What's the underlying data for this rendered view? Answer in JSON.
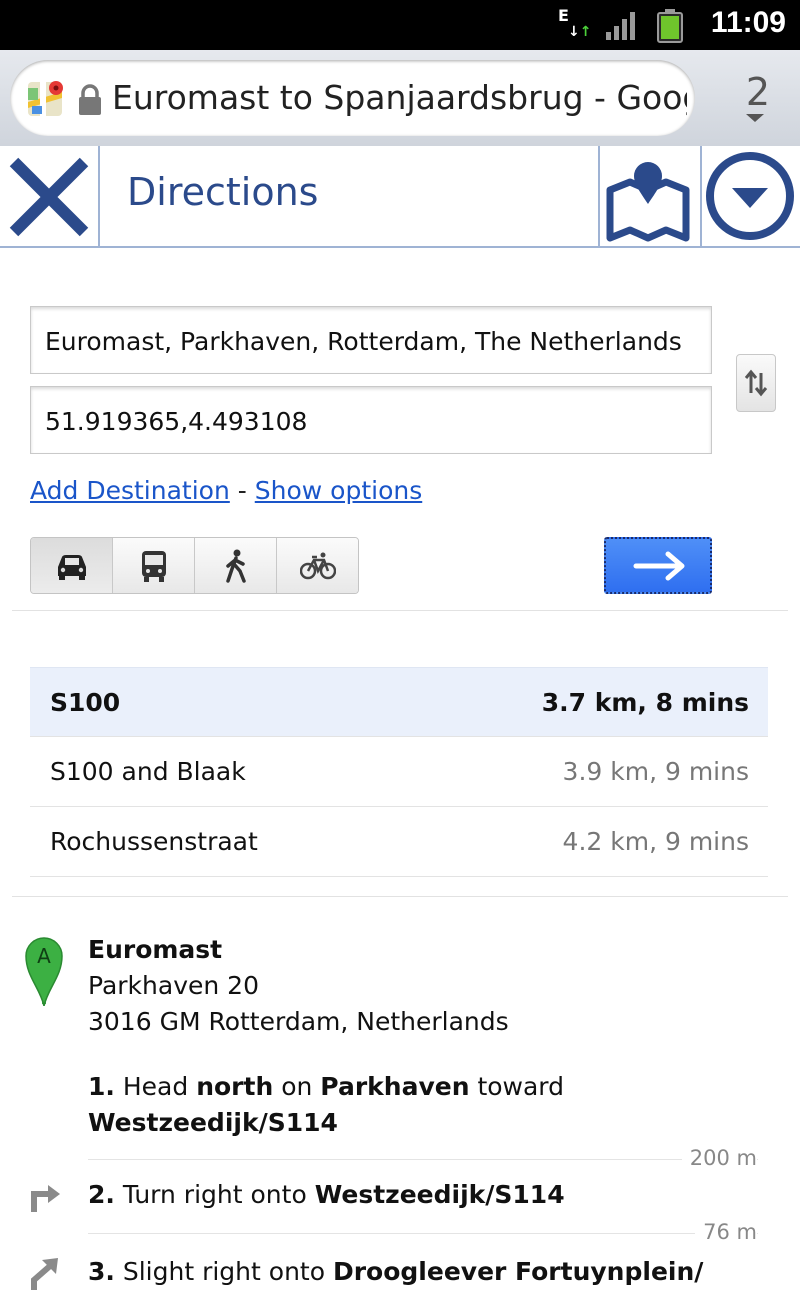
{
  "status_bar": {
    "time": "11:09",
    "network_type": "E"
  },
  "browser": {
    "page_title": "Euromast to Spanjaardsbrug - Google...",
    "tab_count": "2"
  },
  "header": {
    "title": "Directions"
  },
  "form": {
    "origin": "Euromast, Parkhaven, Rotterdam, The Netherlands",
    "destination": "51.919365,4.493108",
    "add_destination": "Add Destination",
    "separator": "-",
    "show_options": "Show options"
  },
  "modes": [
    {
      "icon": "car-icon",
      "selected": true
    },
    {
      "icon": "transit-icon",
      "selected": false
    },
    {
      "icon": "walking-icon",
      "selected": false
    },
    {
      "icon": "bicycle-icon",
      "selected": false
    }
  ],
  "routes": [
    {
      "name": "S100",
      "summary": "3.7 km, 8 mins",
      "selected": true
    },
    {
      "name": "S100 and Blaak",
      "summary": "3.9 km, 9 mins",
      "selected": false
    },
    {
      "name": "Rochussenstraat",
      "summary": "4.2 km, 9 mins",
      "selected": false
    }
  ],
  "start": {
    "marker": "A",
    "name": "Euromast",
    "address_line1": "Parkhaven 20",
    "address_line2": "3016 GM Rotterdam, Netherlands"
  },
  "steps": [
    {
      "num": "1.",
      "parts": [
        "Head ",
        "north",
        " on ",
        "Parkhaven",
        " toward ",
        "Westzeedijk/S114"
      ],
      "distance": "200 m"
    },
    {
      "num": "2.",
      "parts": [
        "Turn right onto ",
        "Westzeedijk/S114"
      ],
      "distance": "76 m"
    },
    {
      "num": "3.",
      "parts": [
        "Slight right onto ",
        "Droogleever Fortuynplein/"
      ]
    }
  ],
  "colors": {
    "accent": "#2b4a8b",
    "link": "#1a55c9",
    "go_button": "#3a7af3",
    "selected_route_bg": "#eaf0fb",
    "marker": "#3cb043"
  }
}
